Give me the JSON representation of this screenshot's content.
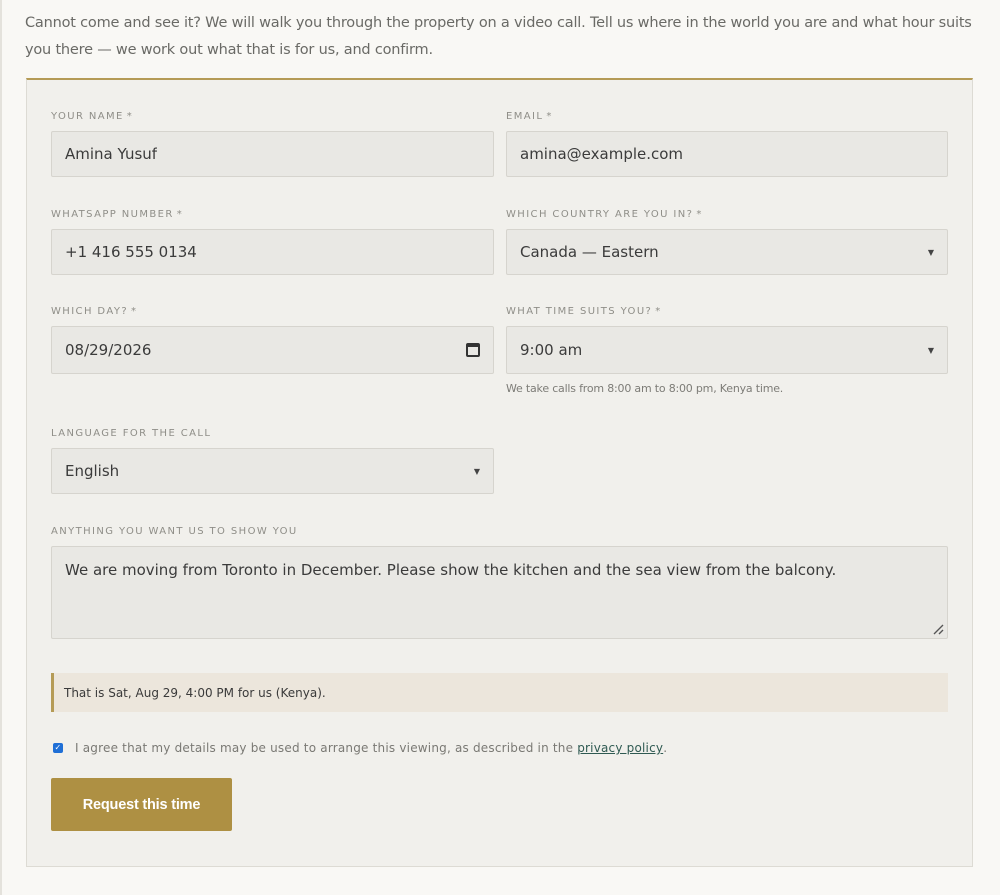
{
  "intro": "Cannot come and see it? We will walk you through the property on a video call. Tell us where in the world you are and what hour suits you there — we work out what that is for us, and confirm.",
  "form": {
    "name": {
      "label": "YOUR NAME",
      "required": "*",
      "value": "Amina Yusuf"
    },
    "email": {
      "label": "EMAIL",
      "required": "*",
      "value": "amina@example.com"
    },
    "whatsapp": {
      "label": "WHATSAPP NUMBER",
      "required": "*",
      "value": "+1 416 555 0134"
    },
    "country": {
      "label": "WHICH COUNTRY ARE YOU IN?",
      "required": "*",
      "value": "Canada — Eastern"
    },
    "day": {
      "label": "WHICH DAY?",
      "required": "*",
      "value": "08/29/2026"
    },
    "time": {
      "label": "WHAT TIME SUITS YOU?",
      "required": "*",
      "value": "9:00 am",
      "hint": "We take calls from 8:00 am to 8:00 pm, Kenya time."
    },
    "language": {
      "label": "LANGUAGE FOR THE CALL",
      "value": "English"
    },
    "notes": {
      "label": "ANYTHING YOU WANT US TO SHOW YOU",
      "value": "We are moving from Toronto in December. Please show the kitchen and the sea view from the balcony."
    },
    "notice": "That is Sat, Aug 29, 4:00 PM for us (Kenya).",
    "consent": {
      "text": "I agree that my details may be used to arrange this viewing, as described in the",
      "link": "privacy policy",
      "suffix": "."
    },
    "submit_label": "Request this time"
  },
  "icons": {
    "calendar": "calendar-icon",
    "caret": "chevron-down-icon",
    "resize": "resize-handle-icon",
    "check": "check-icon"
  },
  "colors": {
    "accent": "#ae9043",
    "checkbox": "#1f6fd6",
    "link": "#2f5a52"
  }
}
